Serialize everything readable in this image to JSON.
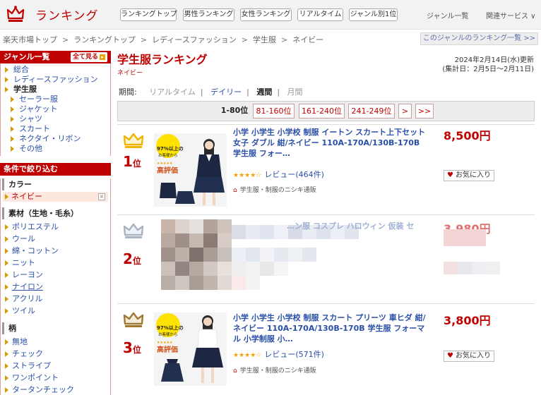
{
  "header": {
    "logo_text": "ランキング",
    "buttons": [
      "ランキングトップ",
      "男性ランキング",
      "女性ランキング",
      "リアルタイム",
      "ジャンル別1位"
    ],
    "links": [
      "ジャンル一覧",
      "関連サービス ∨"
    ]
  },
  "breadcrumb": {
    "items": [
      "楽天市場トップ",
      "ランキングトップ",
      "レディースファッション",
      "学生服",
      "ネイビー"
    ],
    "separator": ">",
    "next_link": "このジャンルのランキング一覧 >>"
  },
  "sidebar": {
    "genre_title": "ジャンル一覧",
    "all_button": "全て見る",
    "genres": [
      {
        "label": "総合",
        "level": 0,
        "current": false
      },
      {
        "label": "レディースファッション",
        "level": 0,
        "current": false
      },
      {
        "label": "学生服",
        "level": 0,
        "current": true
      },
      {
        "label": "セーラー服",
        "level": 1,
        "current": false
      },
      {
        "label": "ジャケット",
        "level": 1,
        "current": false
      },
      {
        "label": "シャツ",
        "level": 1,
        "current": false
      },
      {
        "label": "スカート",
        "level": 1,
        "current": false
      },
      {
        "label": "ネクタイ・リボン",
        "level": 1,
        "current": false
      },
      {
        "label": "その他",
        "level": 1,
        "current": false
      }
    ],
    "filter_title": "条件で絞り込む",
    "color_label": "カラー",
    "color_selected": "ネイビー",
    "color_remove": "×",
    "material_label": "素材（生地・毛糸）",
    "materials": [
      "ポリエステル",
      "ウール",
      "綿・コットン",
      "ニット",
      "レーヨン",
      "ナイロン",
      "アクリル",
      "ツイル"
    ],
    "pattern_label": "柄",
    "patterns": [
      "無地",
      "チェック",
      "ストライプ",
      "ワンポイント",
      "タータンチェック"
    ]
  },
  "main": {
    "title": "学生服ランキング",
    "subtitle": "ネイビー",
    "updated": "2024年2月14日(水)更新",
    "period_range": "(集計日：2月5日〜2月11日)",
    "period": {
      "label": "期間:",
      "options": [
        "リアルタイム",
        "デイリー",
        "週間",
        "月間"
      ]
    },
    "pager": {
      "current": "1-80位",
      "links": [
        "81-160位",
        "161-240位",
        "241-249位",
        ">",
        ">>"
      ]
    }
  },
  "items": [
    {
      "rank": "1",
      "rank_suffix": "位",
      "crown": "gold-crown-icon",
      "name": "小学 小学生 小学校 制服 イートン スカート上下セット 女子 ダブル 紺/ネイビー 110A-170A/130B-170B 学生服 フォー…",
      "rating": "★★★★☆",
      "review": "レビュー(464件)",
      "shop": "学生服・制服のニシキ通販",
      "price": "8,500円",
      "fav": "お気に入り",
      "badge_line1": "97%以上の",
      "badge_line2": "お客様から",
      "badge_big": "高評価"
    },
    {
      "rank": "2",
      "rank_suffix": "位",
      "crown": "silver-crown-icon",
      "name": "…ン服 コスプレ ハロウィン 仮装 セ",
      "price": "3,980円"
    },
    {
      "rank": "3",
      "rank_suffix": "位",
      "crown": "bronze-crown-icon",
      "name": "小学 小学生 小学校 制服 スカート プリーツ 車ヒダ 紺/ネイビー 110A-170A/130B-170B 学生服 フォーマル 小学制服 小…",
      "rating": "★★★★☆",
      "review": "レビュー(571件)",
      "shop": "学生服・制服のニシキ通販",
      "price": "3,800円",
      "fav": "お気に入り",
      "badge_line1": "97%以上の",
      "badge_line2": "お客様から",
      "badge_big": "高評価"
    }
  ],
  "colors": {
    "brand_red": "#bf0000",
    "link_blue": "#2a4fa8",
    "gold": "#f0b400",
    "silver": "#a8b4c0",
    "bronze": "#a07830"
  }
}
